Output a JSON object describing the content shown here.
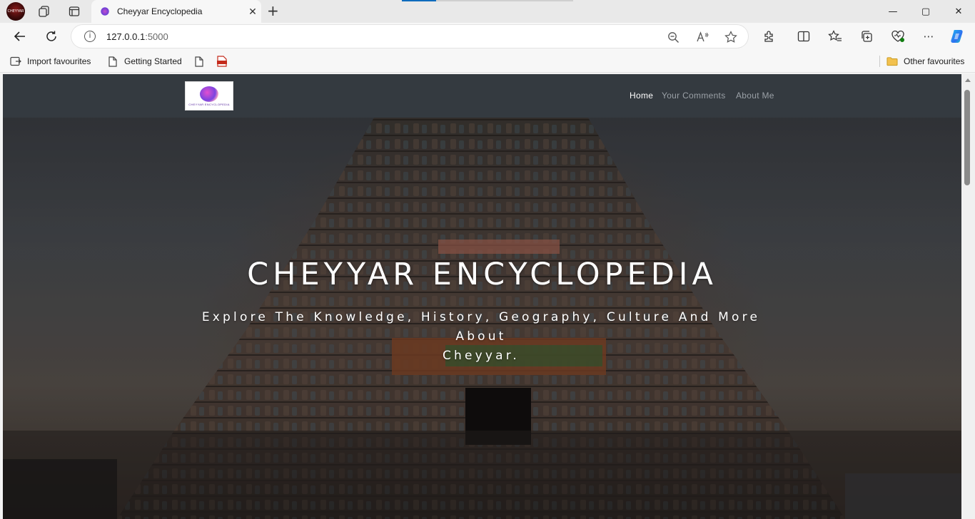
{
  "browser": {
    "profile_label": "CHEYYAR",
    "tab_title": "Cheyyar Encyclopedia",
    "url_host": "127.0.0.1",
    "url_port": ":5000",
    "window_controls": [
      "—",
      "▢",
      "✕"
    ]
  },
  "favourites": {
    "import": "Import favourites",
    "getting_started": "Getting Started",
    "other": "Other favourites"
  },
  "site": {
    "logo_text": "CHEYYAR ENCYCLOPEDIA",
    "nav": [
      {
        "label": "Home",
        "active": true
      },
      {
        "label": "Your Comments",
        "active": false
      },
      {
        "label": "About Me",
        "active": false
      }
    ],
    "hero_title": "CHEYYAR ENCYCLOPEDIA",
    "hero_subtitle_line1": "Explore The Knowledge, History, Geography, Culture And More About",
    "hero_subtitle_line2": "Cheyyar."
  },
  "colors": {
    "navbar_bg": "#343a40",
    "accent": "#0f6cbd"
  }
}
